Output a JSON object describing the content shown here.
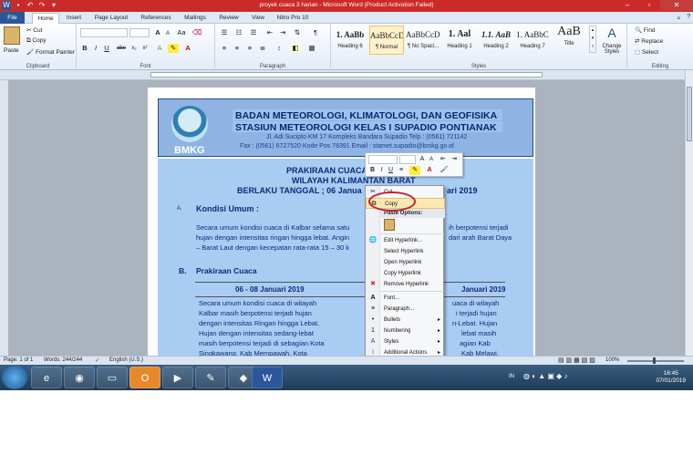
{
  "window": {
    "title": "proyek cuaca 3 harian - Microsoft Word (Product Activation Failed)"
  },
  "ribbon_tabs": [
    "File",
    "Home",
    "Insert",
    "Page Layout",
    "References",
    "Mailings",
    "Review",
    "View",
    "Nitro Pro 10"
  ],
  "clipboard": {
    "paste": "Paste",
    "cut": "Cut",
    "copy": "Copy",
    "format_painter": "Format Painter",
    "label": "Clipboard"
  },
  "font_group": {
    "label": "Font",
    "bold": "B",
    "italic": "I",
    "underline": "U",
    "strike": "abe",
    "sub": "x₂",
    "sup": "x²",
    "grow": "A",
    "shrink": "A",
    "case": "Aa"
  },
  "paragraph_group": {
    "label": "Paragraph",
    "show_marks": "¶"
  },
  "styles": {
    "label": "Styles",
    "items": [
      {
        "sample": "1. AaBb",
        "name": "Heading 6"
      },
      {
        "sample": "AaBbCcDc",
        "name": "¶ Normal"
      },
      {
        "sample": "AaBbCcDc",
        "name": "¶ No Spaci..."
      },
      {
        "sample": "1. Aal",
        "name": "Heading 1"
      },
      {
        "sample": "1.1. AaB",
        "name": "Heading 2"
      },
      {
        "sample": "1. AaBbC",
        "name": "Heading 7"
      },
      {
        "sample": "AaB",
        "name": "Title"
      }
    ],
    "change_styles": "Change Styles"
  },
  "editing": {
    "label": "Editing",
    "find": "Find",
    "replace": "Replace",
    "select": "Select"
  },
  "document": {
    "org1": "BADAN METEOROLOGI, KLIMATOLOGI, DAN GEOFISIKA",
    "org2": "STASIUN METEOROLOGI KELAS  I  SUPADIO PONTIANAK",
    "addr1": "Jl. Adi Sucipto KM 17 Kompleks Bandara  Supadio   Telp : (0561) 721142",
    "addr2": "Fax : (0561) 6727520   Kode Pos 78391     Email : stamet.supadio@bmkg.go.id",
    "logo": "BMKG",
    "h1": "PRAKIRAAN CUACA",
    "h2": "WILAYAH KALIMANTAN BARAT",
    "h3a": "BERLAKU TANGGAL ;  06  Janua",
    "h3b": "ari 2019",
    "secA_letter": "A.",
    "secA": "Kondisi Umum :",
    "pA1": "Secara umum kondisi cuaca di Kalbar selama satu",
    "pA1b": "ih berpotensi  terjadi",
    "pA2": "hujan dengan intensitas ringan hingga lebat.  Angin",
    "pA2b": "dari arah Barat Daya",
    "pA3": "– Barat Laut dengan kecepatan rata-rata 15 – 30 k",
    "secB_letter": "B.",
    "secB": "Prakiraan Cuaca",
    "dateL": "06 - 08 Januari 2019",
    "dateR": "Januari 2019",
    "c1": [
      "Secara umum kondisi cuaca di wilayah",
      "Kalbar     masih berpotensi terjadi hujan",
      "dengan intensitas Ringan hingga Lebat.",
      "Hujan   dengan   intensitas   sedang-lebat",
      "masih berpotensi terjadi di sebagian Kota",
      "Singkawang,  Kab  Mempawah,  Kota"
    ],
    "c2": [
      "uaca di wilayah",
      "i terjadi hujan",
      "n-Lebat.  Hujan",
      "lebat     masih",
      "agian      Kab",
      "Kab Melawi,"
    ]
  },
  "mini_toolbar": {
    "bold": "B",
    "italic": "I",
    "underline": "U",
    "color": "A"
  },
  "context_menu": {
    "items": [
      {
        "label": "Cut",
        "icon": "✂"
      },
      {
        "label": "Copy",
        "icon": "⧉"
      },
      {
        "label": "Paste Options:"
      },
      {
        "label": "Edit Hyperlink...",
        "icon": "🌐"
      },
      {
        "label": "Select Hyperlink"
      },
      {
        "label": "Open Hyperlink"
      },
      {
        "label": "Copy Hyperlink"
      },
      {
        "label": "Remove Hyperlink",
        "icon": "✖"
      },
      {
        "label": "Font...",
        "icon": "A"
      },
      {
        "label": "Paragraph...",
        "icon": "≡"
      },
      {
        "label": "Bullets",
        "icon": "•"
      },
      {
        "label": "Numbering",
        "icon": "1"
      },
      {
        "label": "Styles",
        "icon": "A"
      },
      {
        "label": "Additional Actions",
        "icon": "i"
      }
    ]
  },
  "status": {
    "page": "Page: 1 of 1",
    "words": "Words: 244/244",
    "lang": "English (U.S.)",
    "zoom": "100%"
  },
  "taskbar": {
    "lang": "IN",
    "time": "16:45",
    "date": "07/01/2019"
  }
}
